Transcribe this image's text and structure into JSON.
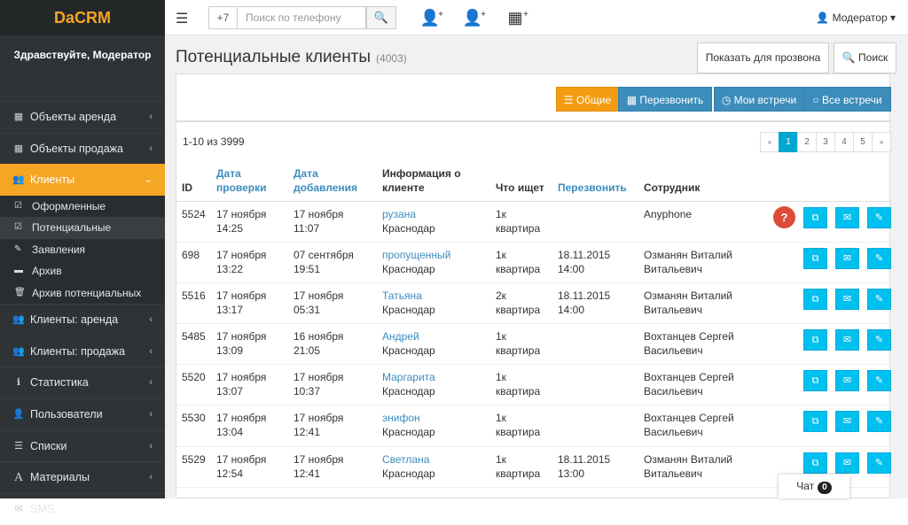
{
  "app": {
    "brand": "DaCRM",
    "greeting": "Здравствуйте, Модератор"
  },
  "sidebar": {
    "items": [
      {
        "label": "Объекты аренда",
        "icon": "building-icon"
      },
      {
        "label": "Объекты продажа",
        "icon": "building-icon"
      },
      {
        "label": "Клиенты",
        "icon": "users-icon",
        "active": true
      },
      {
        "label": "Клиенты: аренда",
        "icon": "users-icon"
      },
      {
        "label": "Клиенты: продажа",
        "icon": "users-icon"
      },
      {
        "label": "Статистика",
        "icon": "info-icon"
      },
      {
        "label": "Пользователи",
        "icon": "user-icon"
      },
      {
        "label": "Списки",
        "icon": "list-icon"
      },
      {
        "label": "Материалы",
        "icon": "font-icon"
      },
      {
        "label": "SMS",
        "icon": "sms-icon"
      }
    ],
    "sub_items": [
      {
        "label": "Оформленные",
        "icon": "checkbox-icon"
      },
      {
        "label": "Потенциальные",
        "icon": "checkbox-icon",
        "active": true
      },
      {
        "label": "Заявления",
        "icon": "edit-icon"
      },
      {
        "label": "Архив",
        "icon": "archive-icon"
      },
      {
        "label": "Архив потенциальных",
        "icon": "trash-icon"
      }
    ]
  },
  "topbar": {
    "phone_prefix": "+7",
    "phone_placeholder": "Поиск по телефону",
    "user_label": "Модератор"
  },
  "page": {
    "title": "Потенциальные клиенты",
    "count": "(4003)",
    "btn_dial": "Показать для прозвона",
    "btn_search": "Поиск"
  },
  "filters": {
    "general": "Общие",
    "callback": "Перезвонить",
    "my_meetings": "Мои встречи",
    "all_meetings": "Все встречи"
  },
  "pagination": {
    "range": "1-10 из 3999",
    "prev": "«",
    "next": "»",
    "pages": [
      "1",
      "2",
      "3",
      "4",
      "5"
    ]
  },
  "table": {
    "headers": {
      "id": "ID",
      "check_date": "Дата проверки",
      "added_date": "Дата добавления",
      "client_info": "Информация о клиенте",
      "looking_for": "Что ищет",
      "callback": "Перезвонить",
      "employee": "Сотрудник"
    },
    "rows": [
      {
        "id": "5524",
        "check_date": "17 ноября",
        "check_time": "14:25",
        "added_date": "17 ноября",
        "added_time": "11:07",
        "name": "рузана",
        "city": "Краснодар",
        "look1": "1к",
        "look2": "квартира",
        "cb_date": "",
        "cb_time": "",
        "emp1": "Anyphone",
        "emp2": "",
        "question": "?"
      },
      {
        "id": "698",
        "check_date": "17 ноября",
        "check_time": "13:22",
        "added_date": "07 сентября",
        "added_time": "19:51",
        "name": "пропущенный",
        "city": "Краснодар",
        "look1": "1к",
        "look2": "квартира",
        "cb_date": "18.11.2015",
        "cb_time": "14:00",
        "emp1": "Озманян Виталий",
        "emp2": "Витальевич"
      },
      {
        "id": "5516",
        "check_date": "17 ноября",
        "check_time": "13:17",
        "added_date": "17 ноября",
        "added_time": "05:31",
        "name": "Татьяна",
        "city": "Краснодар",
        "look1": "2к",
        "look2": "квартира",
        "cb_date": "18.11.2015",
        "cb_time": "14:00",
        "emp1": "Озманян Виталий",
        "emp2": "Витальевич"
      },
      {
        "id": "5485",
        "check_date": "17 ноября",
        "check_time": "13:09",
        "added_date": "16 ноября",
        "added_time": "21:05",
        "name": "Андрей",
        "city": "Краснодар",
        "look1": "1к",
        "look2": "квартира",
        "cb_date": "",
        "cb_time": "",
        "emp1": "Вохтанцев Сергей",
        "emp2": "Васильевич"
      },
      {
        "id": "5520",
        "check_date": "17 ноября",
        "check_time": "13:07",
        "added_date": "17 ноября",
        "added_time": "10:37",
        "name": "Маргарита",
        "city": "Краснодар",
        "look1": "1к",
        "look2": "квартира",
        "cb_date": "",
        "cb_time": "",
        "emp1": "Вохтанцев Сергей",
        "emp2": "Васильевич"
      },
      {
        "id": "5530",
        "check_date": "17 ноября",
        "check_time": "13:04",
        "added_date": "17 ноября",
        "added_time": "12:41",
        "name": "энифон",
        "city": "Краснодар",
        "look1": "1к",
        "look2": "квартира",
        "cb_date": "",
        "cb_time": "",
        "emp1": "Вохтанцев Сергей",
        "emp2": "Васильевич"
      },
      {
        "id": "5529",
        "check_date": "17 ноября",
        "check_time": "12:54",
        "added_date": "17 ноября",
        "added_time": "12:41",
        "name": "Светлана",
        "city": "Краснодар",
        "look1": "1к",
        "look2": "квартира",
        "cb_date": "18.11.2015",
        "cb_time": "13:00",
        "emp1": "Озманян Виталий",
        "emp2": "Витальевич"
      }
    ]
  },
  "chat": {
    "label": "Чат",
    "count": "0"
  }
}
